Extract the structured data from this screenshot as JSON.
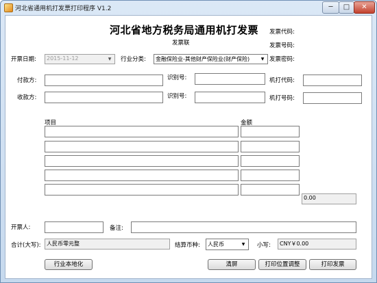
{
  "window": {
    "title": "河北省通用机打发票打印程序 V1.2",
    "minimize": "─",
    "maximize": "□",
    "close": "✕"
  },
  "invoice": {
    "title": "河北省地方税务局通用机打发票",
    "subtitle": "发票联",
    "code_label": "发票代码:",
    "number_label": "发票号码:",
    "password_label": "发票密码:",
    "date_label": "开票日期:",
    "date_value": "2015-11-12",
    "industry_label": "行业分类:",
    "industry_value": "金融保险业-其他财产保险业(财产保险)",
    "payer_label": "付款方:",
    "payee_label": "收款方:",
    "id_label_1": "识别号:",
    "id_label_2": "识别号:",
    "machine_code_label": "机打代码:",
    "machine_number_label": "机打号码:",
    "items_header": "项目",
    "amount_header": "金额",
    "amount_total": "0.00",
    "issuer_label": "开票人:",
    "remark_label": "备注:",
    "total_cn_label": "合计(大写):",
    "total_cn_value": "人民币零元整",
    "currency_label": "结算币种:",
    "currency_value": "人民币",
    "small_label": "小写:",
    "small_value": "CNY￥0.00"
  },
  "buttons": {
    "localize": "行业本地化",
    "clear": "清屏",
    "print_adjust": "打印位置调整",
    "print": "打印发票"
  }
}
